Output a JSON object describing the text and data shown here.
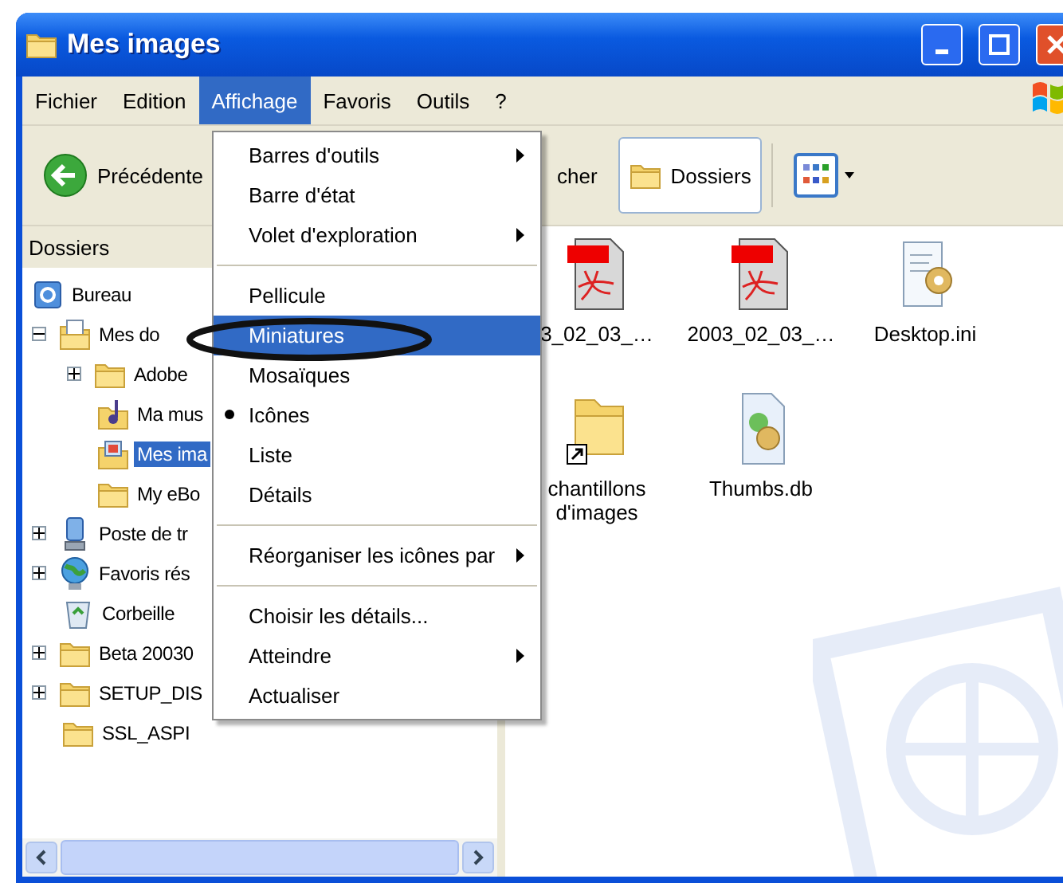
{
  "window": {
    "title": "Mes images"
  },
  "menu_bar": [
    {
      "label": "Fichier",
      "selected": false
    },
    {
      "label": "Edition",
      "selected": false
    },
    {
      "label": "Affichage",
      "selected": true
    },
    {
      "label": "Favoris",
      "selected": false
    },
    {
      "label": "Outils",
      "selected": false
    },
    {
      "label": "?",
      "selected": false
    }
  ],
  "toolbar": {
    "back": "Précédente",
    "search": "cher",
    "folders": {
      "label": "Dossiers",
      "selected": true
    }
  },
  "folders_pane": {
    "title": "Dossiers",
    "tree": [
      {
        "label": "Bureau",
        "kind": "desktop",
        "selected": false,
        "children": [
          {
            "label": "Mes do",
            "kind": "documents",
            "expanded": true,
            "selected": false,
            "children": [
              {
                "label": "Adobe",
                "kind": "folder",
                "expanded": false,
                "selected": false
              },
              {
                "label": "Ma mus",
                "kind": "music",
                "selected": false
              },
              {
                "label": "Mes ima",
                "kind": "pictures",
                "selected": true
              },
              {
                "label": "My eBo",
                "kind": "folder",
                "selected": false
              }
            ]
          },
          {
            "label": "Poste de tr",
            "kind": "computer",
            "expanded": false,
            "selected": false
          },
          {
            "label": "Favoris rés",
            "kind": "network",
            "expanded": false,
            "selected": false
          },
          {
            "label": "Corbeille",
            "kind": "recycle",
            "selected": false
          },
          {
            "label": "Beta 20030",
            "kind": "folder",
            "expanded": false,
            "selected": false
          },
          {
            "label": "SETUP_DIS",
            "kind": "folder",
            "expanded": false,
            "selected": false
          },
          {
            "label": "SSL_ASPI",
            "kind": "folder",
            "selected": false
          }
        ]
      }
    ]
  },
  "files": [
    {
      "name": "3_02_03_…",
      "kind": "pdf"
    },
    {
      "name": "2003_02_03_…",
      "kind": "pdf"
    },
    {
      "name": "Desktop.ini",
      "kind": "ini"
    },
    {
      "name": "chantillons d'images",
      "kind": "shortcut-folder"
    },
    {
      "name": "Thumbs.db",
      "kind": "db"
    }
  ],
  "view_menu": [
    {
      "kind": "item",
      "label": "Barres d'outils",
      "submenu": true,
      "checked": false,
      "selected": false
    },
    {
      "kind": "item",
      "label": "Barre d'état",
      "submenu": false,
      "checked": false,
      "selected": false
    },
    {
      "kind": "item",
      "label": "Volet d'exploration",
      "submenu": true,
      "checked": false,
      "selected": false
    },
    {
      "kind": "separator"
    },
    {
      "kind": "item",
      "label": "Pellicule",
      "submenu": false,
      "checked": false,
      "selected": false
    },
    {
      "kind": "item",
      "label": "Miniatures",
      "submenu": false,
      "checked": false,
      "selected": true
    },
    {
      "kind": "item",
      "label": "Mosaïques",
      "submenu": false,
      "checked": false,
      "selected": false
    },
    {
      "kind": "item",
      "label": "Icônes",
      "submenu": false,
      "checked": true,
      "selected": false
    },
    {
      "kind": "item",
      "label": "Liste",
      "submenu": false,
      "checked": false,
      "selected": false
    },
    {
      "kind": "item",
      "label": "Détails",
      "submenu": false,
      "checked": false,
      "selected": false
    },
    {
      "kind": "separator"
    },
    {
      "kind": "item",
      "label": "Réorganiser les icônes par",
      "submenu": true,
      "checked": false,
      "selected": false
    },
    {
      "kind": "separator"
    },
    {
      "kind": "item",
      "label": "Choisir les détails...",
      "submenu": false,
      "checked": false,
      "selected": false
    },
    {
      "kind": "item",
      "label": "Atteindre",
      "submenu": true,
      "checked": false,
      "selected": false
    },
    {
      "kind": "item",
      "label": "Actualiser",
      "submenu": false,
      "checked": false,
      "selected": false
    }
  ]
}
